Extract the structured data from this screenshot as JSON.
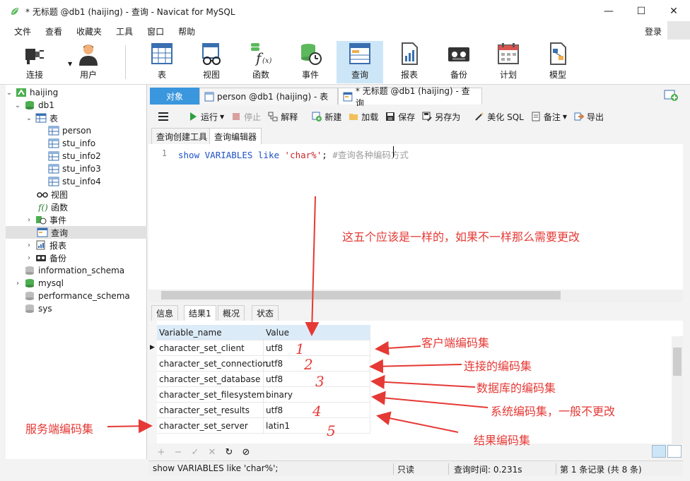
{
  "window": {
    "title": "* 无标题 @db1 (haijing) - 查询 - Navicat for MySQL",
    "controls": {
      "minimize": "—",
      "maximize": "☐",
      "close": "✕"
    }
  },
  "menu": [
    "文件",
    "查看",
    "收藏夹",
    "工具",
    "窗口",
    "帮助"
  ],
  "login_label": "登录",
  "toolbar": [
    "连接",
    "用户",
    "表",
    "视图",
    "函数",
    "事件",
    "查询",
    "报表",
    "备份",
    "计划",
    "模型"
  ],
  "tree": [
    {
      "label": "haijing",
      "icon": "connection-icon"
    },
    {
      "label": "db1",
      "icon": "database-icon"
    },
    {
      "label": "表",
      "icon": "tables-folder-icon"
    },
    {
      "label": "person",
      "icon": "table-icon"
    },
    {
      "label": "stu_info",
      "icon": "table-icon"
    },
    {
      "label": "stu_info2",
      "icon": "table-icon"
    },
    {
      "label": "stu_info3",
      "icon": "table-icon"
    },
    {
      "label": "stu_info4",
      "icon": "table-icon"
    },
    {
      "label": "视图",
      "icon": "view-icon"
    },
    {
      "label": "函数",
      "icon": "function-icon"
    },
    {
      "label": "事件",
      "icon": "event-icon"
    },
    {
      "label": "查询",
      "icon": "query-icon"
    },
    {
      "label": "报表",
      "icon": "report-icon"
    },
    {
      "label": "备份",
      "icon": "backup-icon"
    },
    {
      "label": "information_schema",
      "icon": "database-icon"
    },
    {
      "label": "mysql",
      "icon": "database-icon"
    },
    {
      "label": "performance_schema",
      "icon": "database-icon"
    },
    {
      "label": "sys",
      "icon": "database-icon"
    }
  ],
  "tabs": [
    "对象",
    "person @db1 (haijing) - 表",
    "* 无标题 @db1 (haijing) - 查询"
  ],
  "query_toolbar": [
    "运行",
    "停止",
    "解释",
    "新建",
    "加载",
    "保存",
    "另存为",
    "美化 SQL",
    "备注",
    "导出"
  ],
  "subtabs": [
    "查询创建工具",
    "查询编辑器"
  ],
  "editor": {
    "line_number": "1",
    "kw1": "show",
    "kw2": "VARIABLES",
    "kw3": "like",
    "str": "'char%'",
    "semi": ";",
    "comment": "#查询各种编码方式"
  },
  "result_tabs": [
    "信息",
    "结果1",
    "概况",
    "状态"
  ],
  "grid": {
    "columns": [
      "Variable_name",
      "Value"
    ],
    "rows": [
      [
        "character_set_client",
        "utf8"
      ],
      [
        "character_set_connection",
        "utf8"
      ],
      [
        "character_set_database",
        "utf8"
      ],
      [
        "character_set_filesystem",
        "binary"
      ],
      [
        "character_set_results",
        "utf8"
      ],
      [
        "character_set_server",
        "latin1"
      ]
    ]
  },
  "grid_footer": [
    "+",
    "−",
    "✓",
    "✕",
    "↻",
    "⊘"
  ],
  "status": {
    "sql": "show VARIABLES like 'char%';",
    "readonly": "只读",
    "query_time": "查询时间: 0.231s",
    "records": "第 1 条记录 (共 8 条)"
  },
  "annotations": {
    "top_note": "这五个应该是一样的，如果不一样那么需要更改",
    "client": "客户端编码集",
    "connection": "连接的编码集",
    "database": "数据库的编码集",
    "system": "系统编码集，一般不更改",
    "results": "结果编码集",
    "server": "服务端编码集",
    "hw": [
      "1",
      "2",
      "3",
      "4",
      "5"
    ]
  },
  "colors": {
    "accent": "#3a96dd",
    "annotation": "#e53935",
    "active_toolbar": "#cde6f7"
  }
}
